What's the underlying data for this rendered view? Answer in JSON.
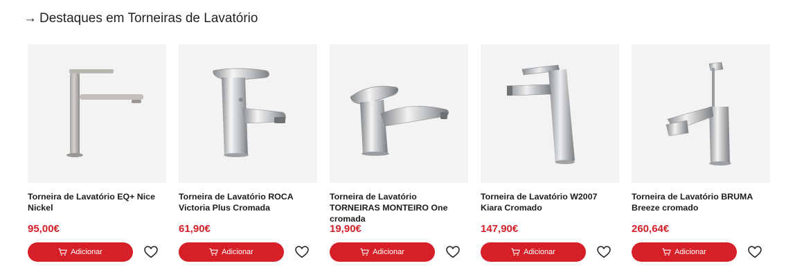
{
  "section": {
    "arrow": "→",
    "title": "Destaques em Torneiras de Lavatório"
  },
  "colors": {
    "accent": "#d71f28",
    "price": "#d61f26",
    "image_bg": "#f3f3f3"
  },
  "icons": {
    "cart": "cart-icon",
    "favorite": "heart-icon"
  },
  "products": [
    {
      "name": "Torneira de Lavatório EQ+ Nice Nickel",
      "price": "95,00€",
      "button": "Adicionar"
    },
    {
      "name": "Torneira de Lavatório ROCA Victoria Plus Cromada",
      "price": "61,90€",
      "button": "Adicionar"
    },
    {
      "name": "Torneira de Lavatório TORNEIRAS MONTEIRO One cromada",
      "price": "19,90€",
      "button": "Adicionar"
    },
    {
      "name": "Torneira de Lavatório W2007 Kiara Cromado",
      "price": "147,90€",
      "button": "Adicionar"
    },
    {
      "name": "Torneira de Lavatório BRUMA Breeze cromado",
      "price": "260,64€",
      "button": "Adicionar"
    }
  ]
}
